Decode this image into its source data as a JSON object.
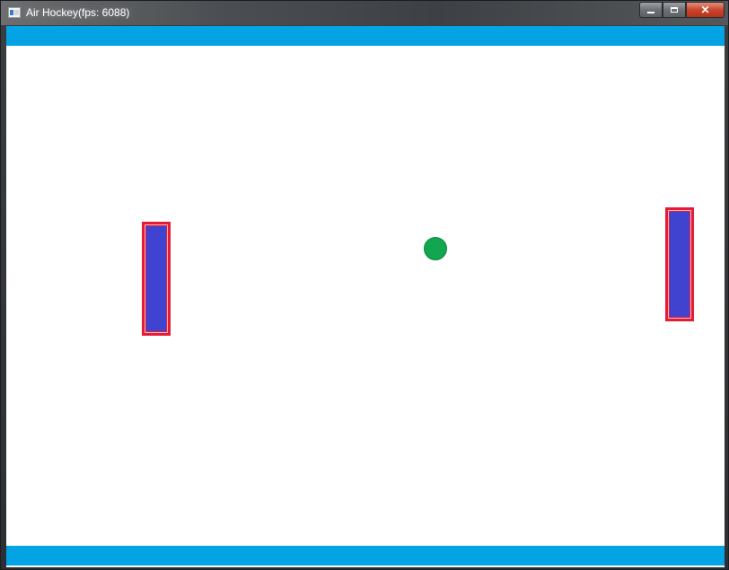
{
  "window": {
    "title": "Air Hockey(fps: 6088)",
    "icon": "app-window-icon",
    "controls": {
      "minimize_glyph": "",
      "maximize_glyph": "",
      "close_glyph": "✕"
    }
  },
  "game": {
    "colors": {
      "background": "#ffffff",
      "wall": "#03a3e4",
      "paddle_fill": "#4043cf",
      "paddle_border": "#e31d38",
      "paddle_bevel": "#f6b6bf",
      "puck": "#12a651"
    }
  }
}
